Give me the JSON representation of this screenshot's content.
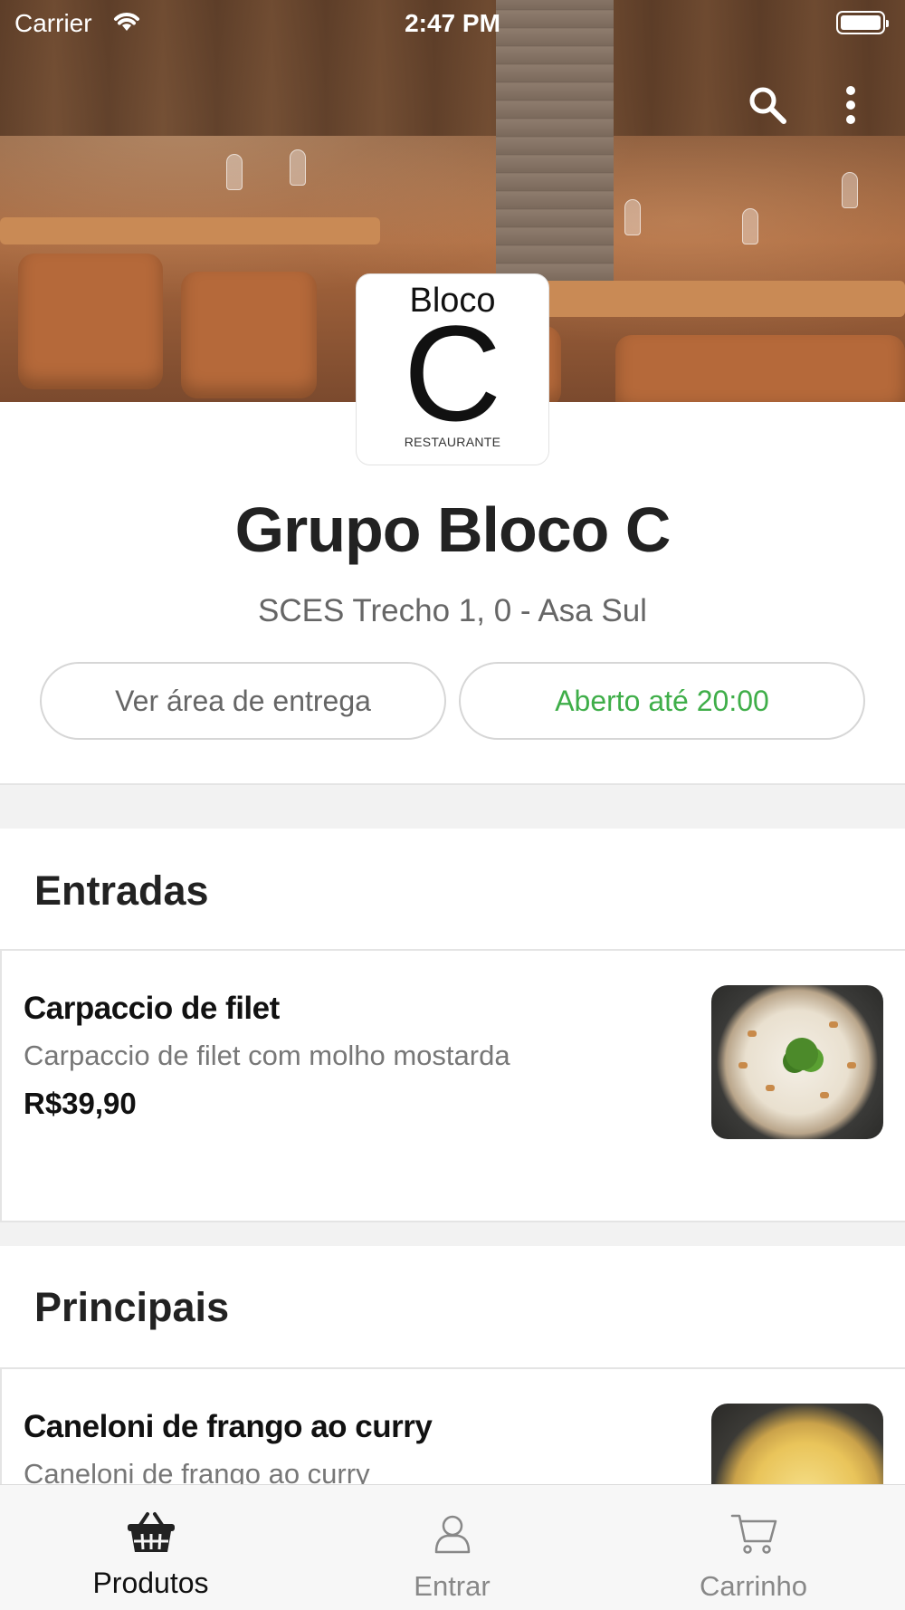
{
  "status_bar": {
    "carrier": "Carrier",
    "time": "2:47 PM"
  },
  "header": {
    "search_icon": "search-icon",
    "more_icon": "more-vertical-icon"
  },
  "logo": {
    "line1": "Bloco",
    "letter": "C",
    "line2": "RESTAURANTE"
  },
  "store": {
    "name": "Grupo Bloco C",
    "address": "SCES Trecho 1, 0 - Asa Sul",
    "delivery_area_label": "Ver área de entrega",
    "open_status": "Aberto até 20:00",
    "open_status_color": "#3fae49"
  },
  "sections": [
    {
      "title": "Entradas",
      "products": [
        {
          "name": "Carpaccio de filet",
          "description": "Carpaccio de filet com molho mostarda",
          "price": "R$39,90"
        }
      ]
    },
    {
      "title": "Principais",
      "products": [
        {
          "name": "Caneloni de frango ao curry",
          "description": "Caneloni de frango ao curry"
        }
      ]
    }
  ],
  "tab_bar": {
    "items": [
      {
        "label": "Produtos",
        "icon": "basket-icon",
        "active": true
      },
      {
        "label": "Entrar",
        "icon": "user-icon",
        "active": false
      },
      {
        "label": "Carrinho",
        "icon": "cart-icon",
        "active": false
      }
    ]
  }
}
